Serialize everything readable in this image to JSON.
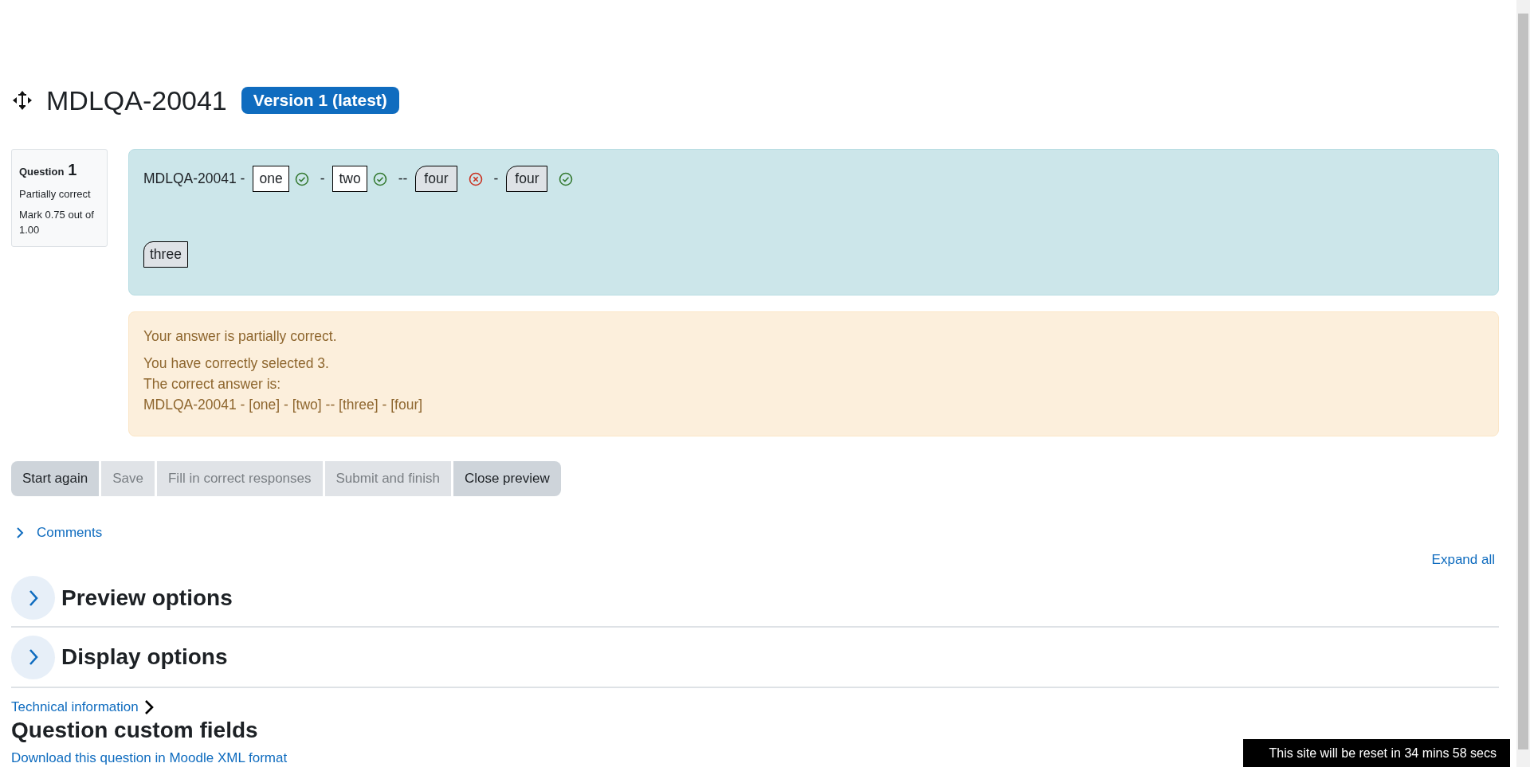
{
  "header": {
    "title": "MDLQA-20041",
    "version_badge": "Version 1 (latest)"
  },
  "question_info": {
    "label": "Question",
    "number": "1",
    "state": "Partially correct",
    "mark": "Mark 0.75 out of 1.00"
  },
  "question": {
    "gaps": [
      {
        "before": "MDLQA-20041 -",
        "answer": "one",
        "kind": "box",
        "correct": true
      },
      {
        "before": "-",
        "answer": "two",
        "kind": "box",
        "correct": true
      },
      {
        "before": "--",
        "answer": "four",
        "kind": "drag",
        "correct": false
      },
      {
        "before": "-",
        "answer": "four",
        "kind": "drag",
        "correct": true
      }
    ],
    "choices": [
      "three"
    ]
  },
  "feedback": {
    "summary": "Your answer is partially correct.",
    "lines": [
      "You have correctly selected 3.",
      "The correct answer is:",
      "MDLQA-20041 - [one] - [two] -- [three] - [four]"
    ]
  },
  "buttons": [
    {
      "label": "Start again",
      "disabled": false
    },
    {
      "label": "Save",
      "disabled": true
    },
    {
      "label": "Fill in correct responses",
      "disabled": true
    },
    {
      "label": "Submit and finish",
      "disabled": true
    },
    {
      "label": "Close preview",
      "disabled": false
    }
  ],
  "comments_link": "Comments",
  "expand_all": "Expand all",
  "sections": [
    {
      "title": "Preview options",
      "expanded": false
    },
    {
      "title": "Display options",
      "expanded": false
    }
  ],
  "technical_information": "Technical information",
  "custom_fields_heading": "Question custom fields",
  "download_link": "Download this question in Moodle XML format",
  "reset_banner": "This site will be reset in 34 mins 58 secs"
}
